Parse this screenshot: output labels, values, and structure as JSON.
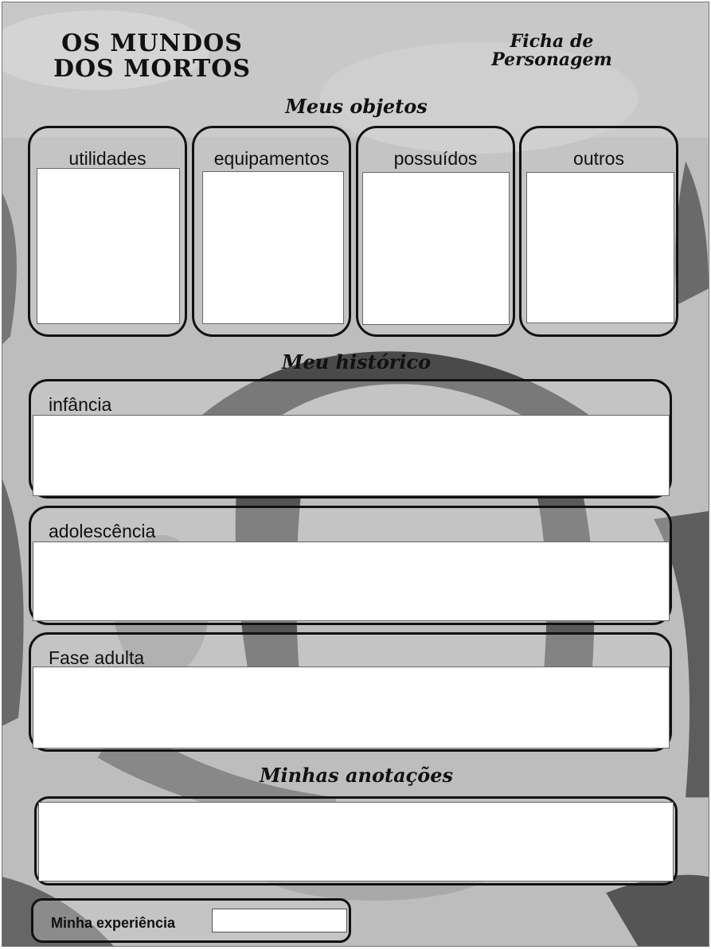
{
  "header": {
    "game_title_line1": "OS MUNDOS",
    "game_title_line2": "DOS MORTOS",
    "sheet_title_line1": "Ficha de",
    "sheet_title_line2": "Personagem"
  },
  "objects": {
    "section_title": "Meus objetos",
    "boxes": [
      {
        "label": "utilidades"
      },
      {
        "label": "equipamentos"
      },
      {
        "label": "possuídos"
      },
      {
        "label": "outros"
      }
    ]
  },
  "history": {
    "section_title": "Meu histórico",
    "boxes": [
      {
        "label": "infância"
      },
      {
        "label": "adolescência"
      },
      {
        "label": "Fase adulta"
      }
    ]
  },
  "notes": {
    "section_title": "Minhas anotações"
  },
  "experience": {
    "label": "Minha experiência",
    "value": ""
  },
  "colors": {
    "background": "#b9b9b9",
    "border": "#111111",
    "field": "#ffffff"
  }
}
